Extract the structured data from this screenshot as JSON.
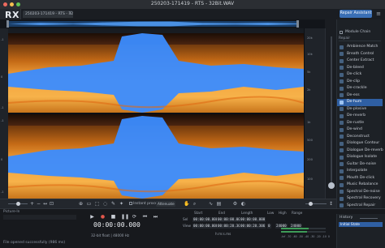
{
  "window": {
    "title": "250203-171419 - RTS - 32Bit.WAV",
    "traffic_lights": [
      "#ed6a5e",
      "#f5bf4f",
      "#61c554"
    ]
  },
  "logo": {
    "text": "RX",
    "subtitle": "ADVANCED"
  },
  "file_tab": {
    "label": "250203-171419 - RTS - 32Bit.WAV",
    "close_glyph": "×"
  },
  "header": {
    "repair_assistant_label": "Repair Assistant",
    "menu_icon": "hamburger-icon"
  },
  "module_panel": {
    "chain_label": "Module Chain",
    "section_label": "Repair",
    "items": [
      {
        "label": "Ambience Match",
        "selected": false
      },
      {
        "label": "Breath Control",
        "selected": false
      },
      {
        "label": "Center Extract",
        "selected": false
      },
      {
        "label": "De-bleed",
        "selected": false
      },
      {
        "label": "De-click",
        "selected": false
      },
      {
        "label": "De-clip",
        "selected": false
      },
      {
        "label": "De-crackle",
        "selected": false
      },
      {
        "label": "De-ess",
        "selected": false
      },
      {
        "label": "De-hum",
        "selected": true
      },
      {
        "label": "De-plosive",
        "selected": false
      },
      {
        "label": "De-reverb",
        "selected": false
      },
      {
        "label": "De-rustle",
        "selected": false
      },
      {
        "label": "De-wind",
        "selected": false
      },
      {
        "label": "Deconstruct",
        "selected": false
      },
      {
        "label": "Dialogue Contour",
        "selected": false
      },
      {
        "label": "Dialogue De-reverb",
        "selected": false
      },
      {
        "label": "Dialogue Isolate",
        "selected": false
      },
      {
        "label": "Guitar De-noise",
        "selected": false
      },
      {
        "label": "Interpolate",
        "selected": false
      },
      {
        "label": "Mouth De-click",
        "selected": false
      },
      {
        "label": "Music Rebalance",
        "selected": false
      },
      {
        "label": "Spectral De-noise",
        "selected": false
      },
      {
        "label": "Spectral Recovery",
        "selected": false
      },
      {
        "label": "Spectral Repair",
        "selected": false
      }
    ]
  },
  "axes": {
    "freq_labels": [
      "20k",
      "10k",
      "5k",
      "2k",
      "1k",
      "500",
      "200",
      "100"
    ],
    "left_labels": [
      "-1",
      "0",
      "-1",
      "-1",
      "0",
      "-1"
    ]
  },
  "toolbar": {
    "instant_process_label": "Instant process",
    "instant_mode_value": "Attenuate"
  },
  "transport": {
    "timecode": "00:00:00.000",
    "format_info": "32-bit float | 48000 Hz"
  },
  "selection": {
    "headers": [
      "Start",
      "End",
      "Length",
      "Low",
      "High",
      "Range"
    ],
    "row_labels": [
      "Sel",
      "View"
    ],
    "sel_values": [
      "00:00:00.000",
      "00:00:00.000",
      "00:00:00.000"
    ],
    "view_values": [
      "00:00:00.000",
      "00:00:20.306",
      "00:00:20.306"
    ],
    "hz_values": [
      "0",
      "24000",
      "24000"
    ],
    "units_label": "h:m:s.ms"
  },
  "meter": {
    "scale": [
      "-Inf",
      "-70",
      "-60",
      "-50",
      "-40",
      "-30",
      "-20",
      "-10",
      "0"
    ],
    "levels": [
      0.62,
      0.58
    ]
  },
  "history": {
    "title": "History",
    "initial_state": "Initial State",
    "field_label": "Picture-In"
  },
  "status": {
    "message": "File opened successfully (986 ms)"
  },
  "colors": {
    "accent": "#3a6fb5",
    "waveform": "#3b8cff",
    "spectrum_orange": "#f0a040"
  }
}
